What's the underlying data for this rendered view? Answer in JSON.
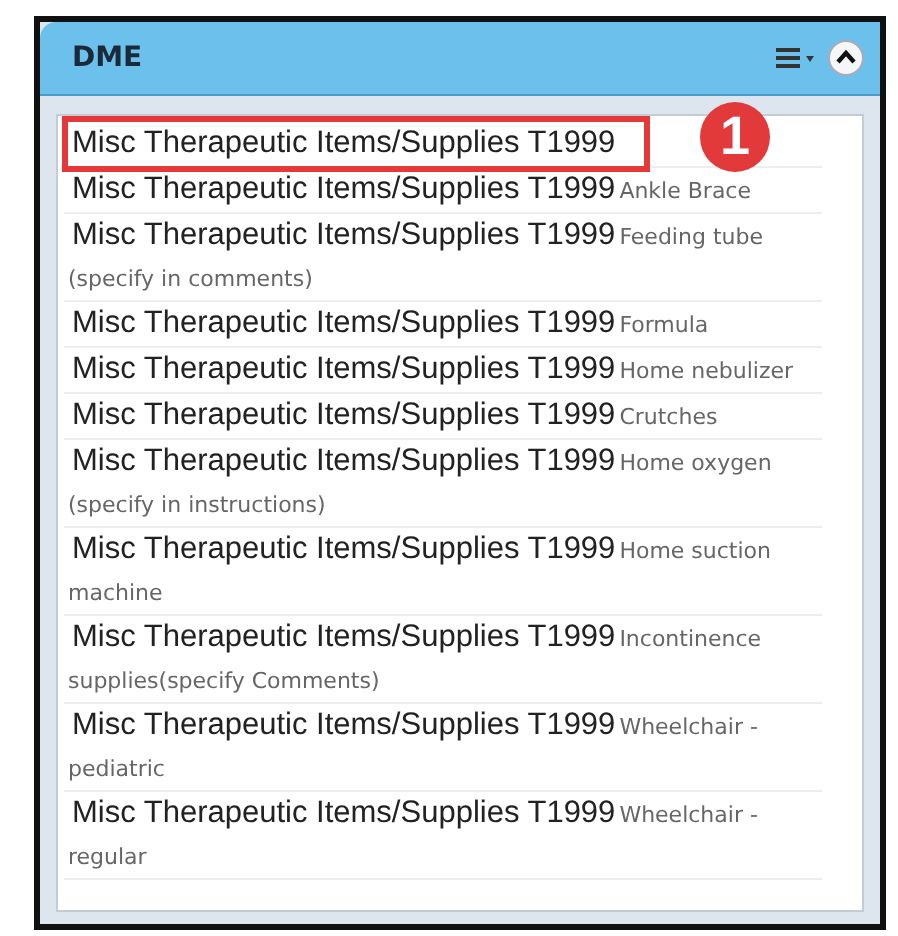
{
  "panel": {
    "title": "DME"
  },
  "items": [
    {
      "name": "Misc Therapeutic Items/Supplies T1999",
      "highlighted": true
    },
    {
      "name": "Misc Therapeutic Items/Supplies T1999",
      "detail": "Ankle Brace",
      "highlighted": false
    },
    {
      "name": "Misc Therapeutic Items/Supplies T1999",
      "detail": "Feeding tube (specify in comments)",
      "highlighted": false
    },
    {
      "name": "Misc Therapeutic Items/Supplies T1999",
      "detail": "Formula",
      "highlighted": false
    },
    {
      "name": "Misc Therapeutic Items/Supplies T1999",
      "detail": "Home nebulizer",
      "highlighted": false
    },
    {
      "name": "Misc Therapeutic Items/Supplies T1999",
      "detail": "Crutches",
      "highlighted": false
    },
    {
      "name": "Misc Therapeutic Items/Supplies T1999",
      "detail": "Home oxygen (specify in instructions)",
      "highlighted": false
    },
    {
      "name": "Misc Therapeutic Items/Supplies T1999",
      "detail": "Home suction machine",
      "highlighted": false
    },
    {
      "name": "Misc Therapeutic Items/Supplies T1999",
      "detail": "Incontinence supplies(specify Comments)",
      "highlighted": false
    },
    {
      "name": "Misc Therapeutic Items/Supplies T1999",
      "detail": "Wheelchair - pediatric",
      "highlighted": false
    },
    {
      "name": "Misc Therapeutic Items/Supplies T1999",
      "detail": "Wheelchair - regular",
      "highlighted": false
    }
  ],
  "callout": {
    "label": "1"
  }
}
